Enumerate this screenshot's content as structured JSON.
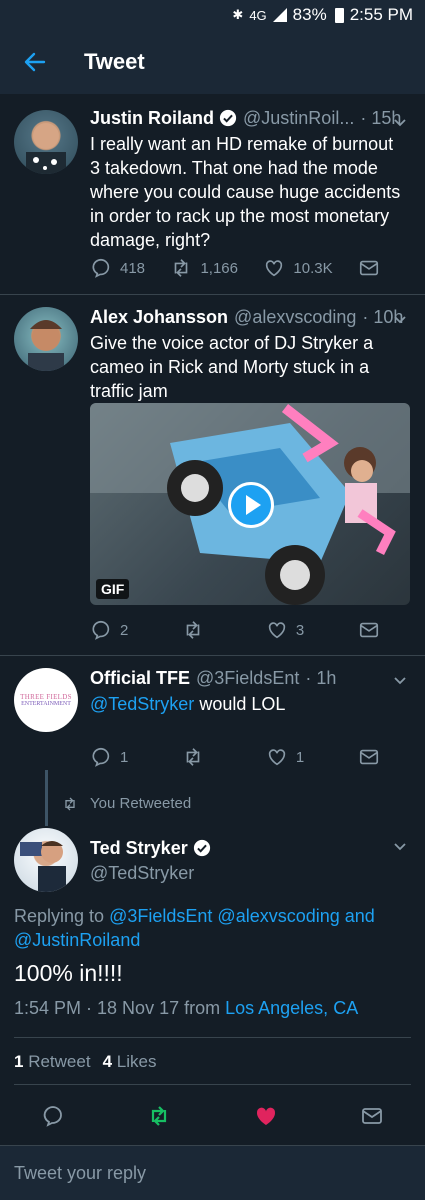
{
  "status_bar": {
    "network": "4G",
    "battery": "83%",
    "time": "2:55 PM"
  },
  "header": {
    "title": "Tweet"
  },
  "tweets": [
    {
      "name": "Justin Roiland",
      "handle": "@JustinRoil...",
      "time": "· 15h",
      "text": "I really want an HD remake of burnout 3 takedown. That one had the mode where you could cause huge accidents in order to rack up the most monetary damage, right?",
      "replies": "418",
      "retweets": "1,166",
      "likes": "10.3K"
    },
    {
      "name": "Alex Johansson",
      "handle": "@alexvscoding",
      "time": "· 10h",
      "text": "Give the voice actor of DJ Stryker a cameo in Rick and Morty stuck in a traffic jam",
      "media_badge": "GIF",
      "replies": "2",
      "retweets": "",
      "likes": "3"
    },
    {
      "name": "Official TFE",
      "handle": "@3FieldsEnt",
      "time": "· 1h",
      "mention": "@TedStryker",
      "text_rest": " would LOL",
      "replies": "1",
      "retweets": "",
      "likes": "1",
      "avatar_text_1": "THREE FIELDS",
      "avatar_text_2": "ENTERTAINMENT"
    }
  ],
  "retweet_note": "You Retweeted",
  "main_tweet": {
    "name": "Ted Stryker",
    "handle": "@TedStryker",
    "replying_label": "Replying to",
    "replying_1": "@3FieldsEnt",
    "replying_2": "@alexvscoding",
    "replying_and": "and",
    "replying_3": "@JustinRoiland",
    "text": "100% in!!!!",
    "timestamp": "1:54 PM · 18 Nov 17 from",
    "location": "Los Angeles, CA",
    "retweet_count": "1",
    "retweet_label": "Retweet",
    "like_count": "4",
    "like_label": "Likes"
  },
  "reply_placeholder": "Tweet your reply",
  "colors": {
    "background": "#141d26",
    "accent": "#1da1f2",
    "like": "#e0245e",
    "retweet": "#17bf63"
  }
}
